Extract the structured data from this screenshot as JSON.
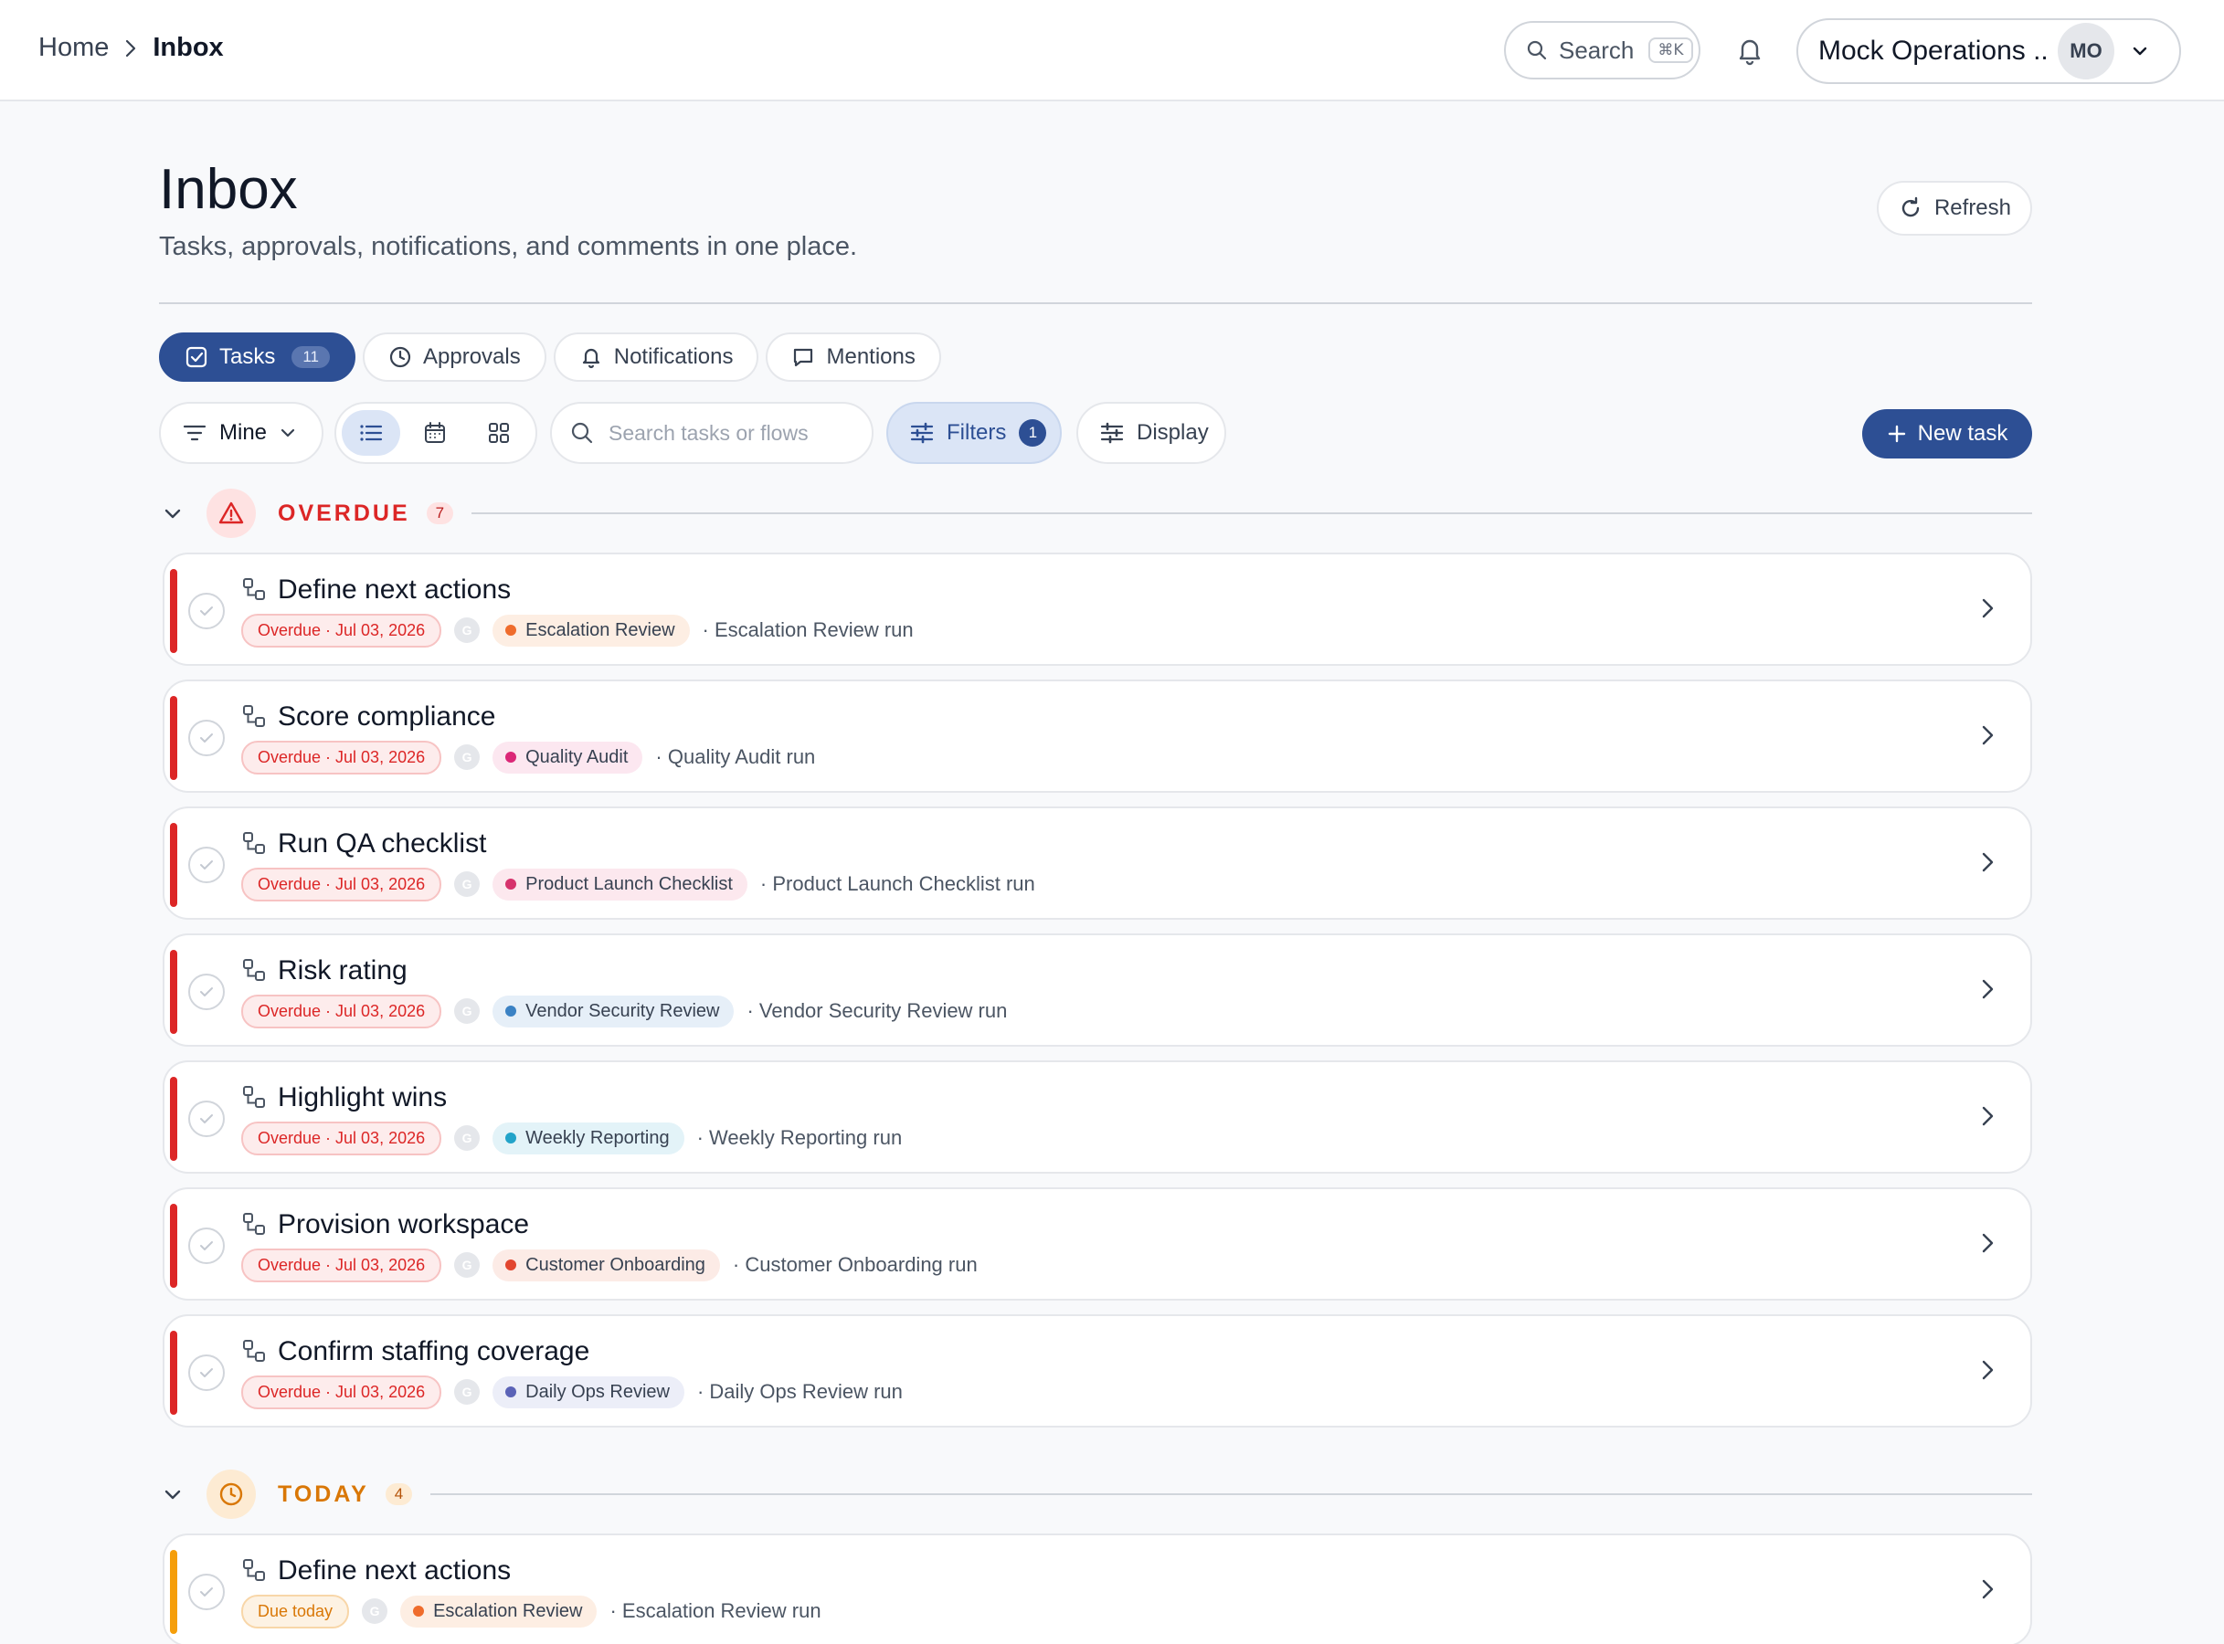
{
  "breadcrumb": {
    "home": "Home",
    "separator": "›",
    "current": "Inbox"
  },
  "topbar": {
    "search_label": "Search",
    "search_shortcut": "⌘K",
    "account_name": "Mock Operations ...",
    "avatar_initials": "MO"
  },
  "header": {
    "title": "Inbox",
    "subtitle": "Tasks, approvals, notifications, and comments in one place.",
    "refresh_label": "Refresh"
  },
  "tabs": [
    {
      "label": "Tasks",
      "count": "11",
      "icon": "checkbox-icon",
      "active": true
    },
    {
      "label": "Approvals",
      "icon": "clock-icon",
      "active": false
    },
    {
      "label": "Notifications",
      "icon": "bell-icon",
      "active": false
    },
    {
      "label": "Mentions",
      "icon": "comment-icon",
      "active": false
    }
  ],
  "toolbar": {
    "scope_label": "Mine",
    "views": [
      "list-view-icon",
      "calendar-view-icon",
      "grid-view-icon"
    ],
    "active_view": "list-view-icon",
    "search_placeholder": "Search tasks or flows",
    "filters_label": "Filters",
    "filters_count": "1",
    "display_label": "Display",
    "new_task_label": "New task"
  },
  "groups": [
    {
      "key": "overdue",
      "label": "OVERDUE",
      "count": "7",
      "icon": "warning-triangle-icon",
      "tasks": [
        {
          "title": "Define next actions",
          "due": "Overdue · Jul 03, 2026",
          "assignee": "G",
          "flow": "Escalation Review",
          "flow_color": "#ef6c2c",
          "flow_bg": "#fdeee3",
          "run": "· Escalation Review run"
        },
        {
          "title": "Score compliance",
          "due": "Overdue · Jul 03, 2026",
          "assignee": "G",
          "flow": "Quality Audit",
          "flow_color": "#db2777",
          "flow_bg": "#fce7f0",
          "run": "· Quality Audit run"
        },
        {
          "title": "Run QA checklist",
          "due": "Overdue · Jul 03, 2026",
          "assignee": "G",
          "flow": "Product Launch Checklist",
          "flow_color": "#d6336c",
          "flow_bg": "#fce8ee",
          "run": "· Product Launch Checklist run"
        },
        {
          "title": "Risk rating",
          "due": "Overdue · Jul 03, 2026",
          "assignee": "G",
          "flow": "Vendor Security Review",
          "flow_color": "#3b82c4",
          "flow_bg": "#e6eff8",
          "run": "· Vendor Security Review run"
        },
        {
          "title": "Highlight wins",
          "due": "Overdue · Jul 03, 2026",
          "assignee": "G",
          "flow": "Weekly Reporting",
          "flow_color": "#22a3c9",
          "flow_bg": "#e3f3f8",
          "run": "· Weekly Reporting run"
        },
        {
          "title": "Provision workspace",
          "due": "Overdue · Jul 03, 2026",
          "assignee": "G",
          "flow": "Customer Onboarding",
          "flow_color": "#e2462f",
          "flow_bg": "#fcebe6",
          "run": "· Customer Onboarding run"
        },
        {
          "title": "Confirm staffing coverage",
          "due": "Overdue · Jul 03, 2026",
          "assignee": "G",
          "flow": "Daily Ops Review",
          "flow_color": "#5b63b7",
          "flow_bg": "#eceef8",
          "run": "· Daily Ops Review run"
        }
      ]
    },
    {
      "key": "today",
      "label": "TODAY",
      "count": "4",
      "icon": "clock-icon",
      "tasks": [
        {
          "title": "Define next actions",
          "due": "Due today",
          "assignee": "G",
          "flow": "Escalation Review",
          "flow_color": "#ef6c2c",
          "flow_bg": "#fdeee3",
          "run": "· Escalation Review run"
        }
      ]
    }
  ],
  "colors": {
    "accent": "#2d4f94",
    "overdue": "#dc2626",
    "today": "#d97706"
  }
}
